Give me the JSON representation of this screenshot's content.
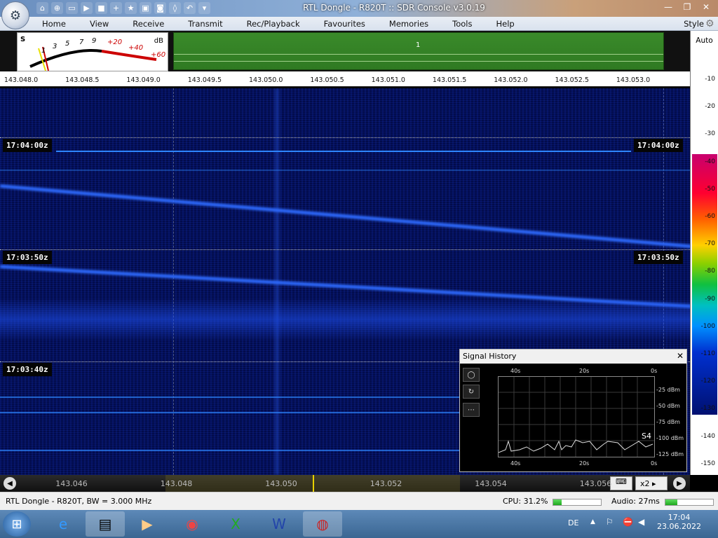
{
  "window": {
    "title": "RTL Dongle - R820T :: SDR Console v3.0.19"
  },
  "menu": {
    "items": [
      "Home",
      "View",
      "Receive",
      "Transmit",
      "Rec/Playback",
      "Favourites",
      "Memories",
      "Tools",
      "Help"
    ],
    "style": "Style"
  },
  "smeter": {
    "s_label": "S",
    "db_label": "dB",
    "scale": [
      "1",
      "3",
      "5",
      "7",
      "9",
      "+20",
      "+40",
      "+60"
    ]
  },
  "spectrum_mini": {
    "marker": "1"
  },
  "freq_scale": {
    "labels": [
      "143.048.0",
      "143.048.5",
      "143.049.0",
      "143.049.5",
      "143.050.0",
      "143.050.5",
      "143.051.0",
      "143.051.5",
      "143.052.0",
      "143.052.5",
      "143.053.0"
    ]
  },
  "db_scale": {
    "auto": "Auto",
    "ticks": [
      "-10",
      "-20",
      "-30",
      "-40",
      "-50",
      "-60",
      "-70",
      "-80",
      "-90",
      "-100",
      "-110",
      "-120",
      "-130",
      "-140",
      "-150"
    ]
  },
  "waterfall": {
    "timestamps": [
      "17:04:00z",
      "17:03:50z",
      "17:03:40z"
    ]
  },
  "signal_history": {
    "title": "Signal History",
    "close": "✕",
    "x_top": [
      "40s",
      "20s",
      "0s"
    ],
    "x_bottom": [
      "40s",
      "20s",
      "0s"
    ],
    "y_labels": [
      "-25 dBm",
      "-50 dBm",
      "-75 dBm",
      "-100 dBm",
      "-125 dBm"
    ],
    "s_value": "S4",
    "buttons": [
      "◯",
      "↻",
      "⋯"
    ]
  },
  "bottom_scale": {
    "labels": [
      "143.046",
      "143.048",
      "143.050",
      "143.052",
      "143.054",
      "143.056"
    ],
    "zoom": "x2",
    "kbd": "⌨"
  },
  "status": {
    "device": "RTL Dongle - R820T, BW = 3.000 MHz",
    "cpu": "CPU: 31.2%",
    "cpu_level": 0.18,
    "audio": "Audio: 27ms",
    "audio_level": 0.25
  },
  "taskbar": {
    "lang": "DE",
    "time": "17:04",
    "date": "23.06.2022"
  }
}
